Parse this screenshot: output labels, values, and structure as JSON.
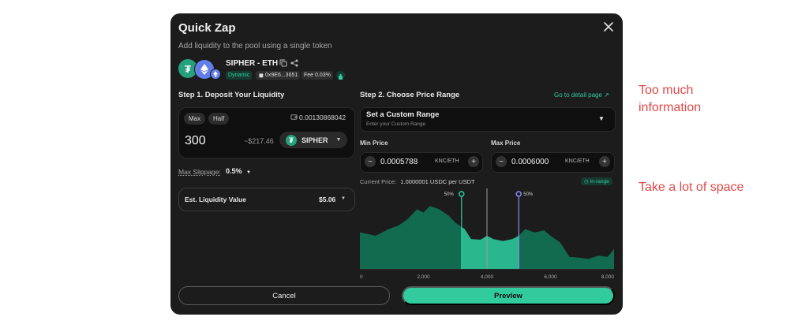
{
  "modal": {
    "title": "Quick Zap",
    "subtitle": "Add liquidity to the pool using a single token",
    "pair_name": "SIPHER - ETH",
    "badge_dynamic": "Dynamic",
    "badge_address": "0x9E6...3651",
    "badge_fee": "Fee 0.03%",
    "icons": [
      "close-icon",
      "copy-icon",
      "share-icon",
      "wallet-icon",
      "gift-icon",
      "chevron-down-icon",
      "minus-icon",
      "plus-icon",
      "external-link-icon"
    ],
    "colors": {
      "accent": "#31cb9e",
      "background": "#1c1c1c",
      "usdt": "#26a17b",
      "eth": "#627eea",
      "max_line": "#8d8cf5"
    }
  },
  "deposit": {
    "step_label": "Step 1. Deposit Your Liquidity",
    "max_label": "Max",
    "half_label": "Half",
    "balance": "0.00130868042",
    "amount": "300",
    "usd_value": "~$217.46",
    "token": "SIPHER",
    "slippage_label": "Max Slippage:",
    "slippage_value": "0.5%",
    "est_label": "Est. Liquidity Value",
    "est_value": "$5.06"
  },
  "range": {
    "step_label": "Step 2. Choose Price Range",
    "detail_link": "Go to detail page ↗",
    "select_title": "Set a Custom Range",
    "select_sub": "Enter your Custom Range",
    "min_label": "Min Price",
    "max_label": "Max Price",
    "min_value": "0.0005788",
    "max_value": "0.0006000",
    "price_unit": "KNC/ETH",
    "current_price_label": "Current Price:",
    "current_price_value": "1.0000001 USDC per USDT",
    "in_range": "In-range"
  },
  "chart_data": {
    "type": "area",
    "x_ticks": [
      "0",
      "2,000",
      "4,000",
      "6,000",
      "8,000"
    ],
    "xlim": [
      0,
      8000
    ],
    "x": [
      0,
      500,
      900,
      1200,
      1500,
      1800,
      2000,
      2200,
      2500,
      2800,
      3000,
      3300,
      3500,
      3800,
      4000,
      4200,
      4500,
      4800,
      5000,
      5200,
      5500,
      5800,
      6000,
      6300,
      6600,
      6900,
      7200,
      7500,
      7800,
      8000
    ],
    "y": [
      0.55,
      0.5,
      0.6,
      0.65,
      0.75,
      0.9,
      0.85,
      0.95,
      0.9,
      0.8,
      0.7,
      0.6,
      0.45,
      0.44,
      0.5,
      0.45,
      0.42,
      0.45,
      0.5,
      0.6,
      0.55,
      0.58,
      0.5,
      0.4,
      0.18,
      0.17,
      0.15,
      0.2,
      0.18,
      0.3
    ],
    "ylim": [
      0,
      1
    ],
    "min_price_x": 3200,
    "current_price_x": 4000,
    "max_price_x": 5000,
    "min_handle_label": "50%",
    "max_handle_label": "50%"
  },
  "actions": {
    "cancel_label": "Cancel",
    "preview_label": "Preview"
  },
  "notes": {
    "note1": "Too much\ninformation",
    "note2": "Take a lot of space"
  }
}
